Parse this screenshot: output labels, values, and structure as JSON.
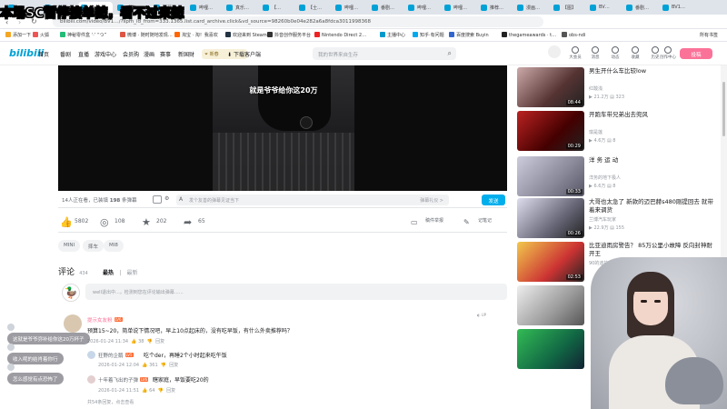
{
  "browser": {
    "tabs": [
      "…",
      "…",
      "哔…",
      "动态…",
      "弹幕…",
      "哔哩…",
      "真乐…",
      "【…",
      "【士…",
      "哔哩…",
      "番剧…",
      "哔哩…",
      "哔哩…",
      "推荐…",
      "漫画…",
      "【图】",
      "BV…",
      "番剧…",
      "BV1…"
    ],
    "url": "bilibili.com/video/BV1…/?spm_id_from=333.1365.list.card_archive.click&vd_source=98260b0e04e282a6a8fdca3011998368",
    "bookmarks": [
      "添加一下",
      "火狐",
      "神秘零件盒 ‘·’ “つ”",
      "微博 · 随时随地发现…",
      "淘宝 · 淘！我喜欢",
      "欢迎来到 Steam",
      "抖音创作服务平台",
      "Nintendo Direct 2…",
      "主播中心",
      "知乎·有问题",
      "百度搜索 Buyin",
      "thegameawards · t…",
      "obs-ndi"
    ],
    "bookmark_other": "所有书签"
  },
  "overlay_title": "本场SC暂停接单辣，看不过来辣",
  "nav": {
    "logo": "bilibili",
    "links": [
      "首页",
      "番剧",
      "直播",
      "游戏中心",
      "会员购",
      "漫画",
      "赛事",
      "新国财"
    ],
    "download": "下载客户端",
    "search_placeholder": "我的世界来自生存",
    "icons": [
      {
        "label": "大会员",
        "icon": "vip-icon"
      },
      {
        "label": "消息",
        "icon": "message-icon"
      },
      {
        "label": "动态",
        "icon": "dynamic-icon"
      },
      {
        "label": "收藏",
        "icon": "favorite-icon"
      },
      {
        "label": "历史",
        "icon": "history-icon"
      },
      {
        "label": "创作中心",
        "icon": "creator-icon"
      }
    ],
    "upload": "投稿"
  },
  "video": {
    "subtitle": "就是爷爷给你这20万"
  },
  "danmaku": {
    "watching_prefix": "14人正在看，已装填",
    "count": "198",
    "suffix": "条弹幕",
    "placeholder": "发个友善的弹幕见证当下",
    "etiquette": "弹幕礼仪 >",
    "send": "发送"
  },
  "actions": {
    "like": "5802",
    "coin": "108",
    "favorite": "202",
    "share": "65",
    "report": "稿件举报",
    "note": "记笔记"
  },
  "tags": [
    "MINI",
    "摔车",
    "MI8"
  ],
  "comments": {
    "title": "评论",
    "count": "434",
    "sort_hot": "最热",
    "sort_new": "最新",
    "input_placeholder": "welI退出中...，检测到您在评论输出弹幕……",
    "items": [
      {
        "name": "提示女友粉",
        "text": "预算15~20，简单说下情况吧，早上10点起床的，没有吃早饭，有什么外卖推荐吗？",
        "date": "2026-01-24 11:34",
        "likes": "38",
        "reply": "回复"
      },
      {
        "name": "狂野的企鹅",
        "text": "吃个der，再睡2个小时起来吃午饭",
        "date": "2026-01-24 12:04",
        "likes": "361",
        "reply": "回复"
      },
      {
        "name": "十年着飞出的子弹",
        "text": "瞎家庭，早饭要吃20的",
        "date": "2026-01-24 11:51",
        "likes": "64",
        "reply": "回复"
      }
    ],
    "more_replies": "共54条回复，点击查看"
  },
  "recommend": [
    {
      "title": "男生开什么车比较low",
      "up": "红酸浅",
      "views": "21.2万",
      "danmaku": "323",
      "duration": "08:44"
    },
    {
      "title": "开跑车带兄弟出去兜风",
      "up": "琪是莲",
      "views": "4.6万",
      "danmaku": "8",
      "duration": "00:29"
    },
    {
      "title": "洋 务 运 动",
      "up": "洋务的地下极人",
      "views": "6.6万",
      "danmaku": "8",
      "duration": "00:33"
    },
    {
      "title": "大哥也太急了 新款的迈巴赫s480刚提回去 就带着来调货",
      "up": "兰博汽车玩家",
      "views": "22.9万",
      "danmaku": "155",
      "duration": "00:26"
    },
    {
      "title": "比亚迪雨房警告？ 85万公里小故障 反向封神耐开王",
      "up": "90的迪拉车",
      "views": "",
      "danmaku": "",
      "duration": "02:53"
    },
    {
      "title": "",
      "up": "",
      "views": "",
      "danmaku": "",
      "duration": ""
    },
    {
      "title": "",
      "up": "",
      "views": "",
      "danmaku": "",
      "duration": ""
    }
  ],
  "chat": [
    "这就是爷爷弥补给你这20万杯子",
    "收入呢的结肖着你行",
    "怎么感觉有点恐怖了"
  ],
  "colors": {
    "accent": "#fb7299",
    "blue": "#00aeec"
  }
}
